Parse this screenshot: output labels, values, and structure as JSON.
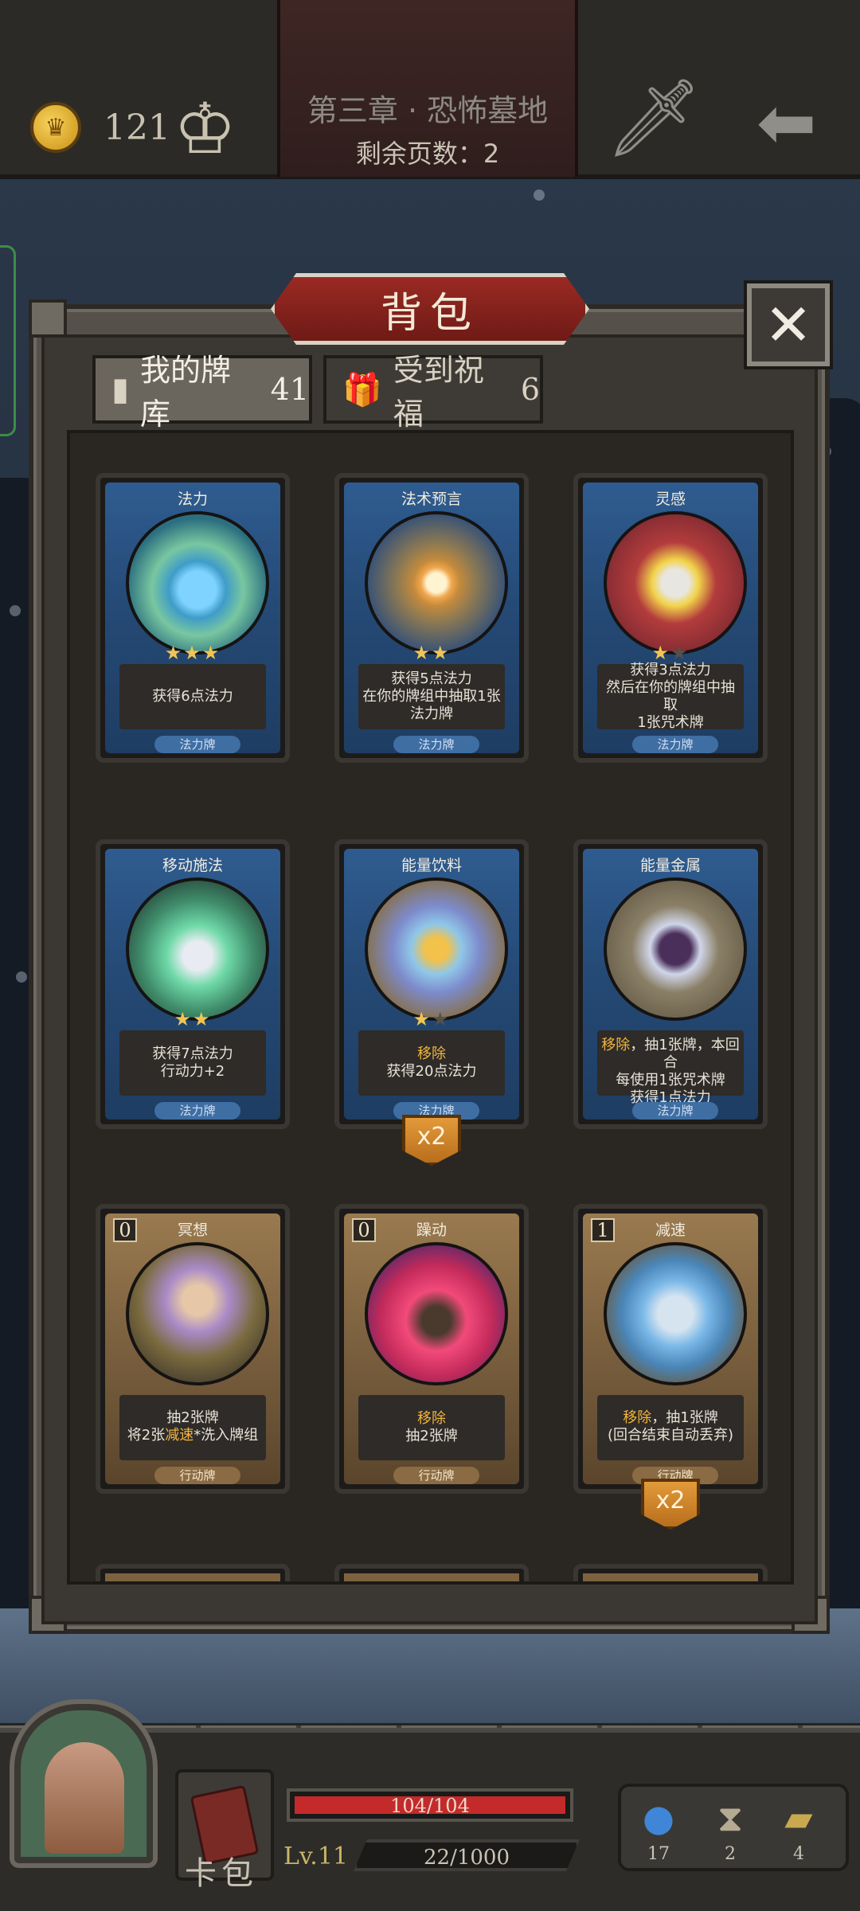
{
  "topbar": {
    "coin_icon": "crown-coin-icon",
    "coins": "121",
    "chapter_title": "第三章 · 恐怖墓地",
    "pages_left": "剩余页数：2"
  },
  "modal": {
    "title": "背包",
    "close_glyph": "✕",
    "tabs": [
      {
        "label": "我的牌库",
        "count": "41",
        "active": true
      },
      {
        "label": "受到祝福",
        "count": "6",
        "active": false
      }
    ]
  },
  "cards": [
    {
      "name": "法力",
      "text": "获得6点法力",
      "type": "法力牌",
      "stars": "★★★",
      "stars_off": ""
    },
    {
      "name": "法术预言",
      "text": "获得5点法力\n在你的牌组中抽取1张\n法力牌",
      "type": "法力牌",
      "stars": "★★",
      "stars_off": ""
    },
    {
      "name": "灵感",
      "text": "获得3点法力\n然后在你的牌组中抽取\n1张咒术牌",
      "type": "法力牌",
      "stars": "★",
      "stars_off": "★"
    },
    {
      "name": "移动施法",
      "text": "获得7点法力\n行动力+2",
      "type": "法力牌",
      "stars": "★★",
      "stars_off": ""
    },
    {
      "name": "能量饮料",
      "keyword": "移除",
      "text": "获得20点法力",
      "type": "法力牌",
      "stars": "★",
      "stars_off": "★",
      "badge": "x2"
    },
    {
      "name": "能量金属",
      "keyword": "移除",
      "text": "，抽1张牌，本回合\n每使用1张咒术牌\n获得1点法力",
      "type": "法力牌",
      "stars": "",
      "stars_off": ""
    },
    {
      "name": "冥想",
      "cost": "0",
      "text_pre": "抽2张牌\n将2张",
      "keyword": "减速",
      "text": "*洗入牌组",
      "type": "行动牌"
    },
    {
      "name": "躁动",
      "cost": "0",
      "keyword": "移除",
      "text": "抽2张牌",
      "type": "行动牌"
    },
    {
      "name": "减速",
      "cost": "1",
      "keyword": "移除",
      "text": "，抽1张牌\n(回合结束自动丢弃)",
      "type": "行动牌",
      "badge": "x2"
    }
  ],
  "hud": {
    "deck_label": "卡包",
    "hp": "104/104",
    "hp_fraction": 1.0,
    "level": "Lv.11",
    "xp": "22/1000",
    "resources": [
      {
        "icon": "potion-icon",
        "value": "17"
      },
      {
        "icon": "hourglass-icon",
        "value": "2"
      },
      {
        "icon": "cards-icon",
        "value": "4"
      }
    ]
  },
  "colors": {
    "spell_card": "#2f5c90",
    "action_card": "#9a7a4f",
    "highlight": "#f2b43d",
    "hp": "#c42a2a",
    "title_plate": "#9a2a23"
  }
}
